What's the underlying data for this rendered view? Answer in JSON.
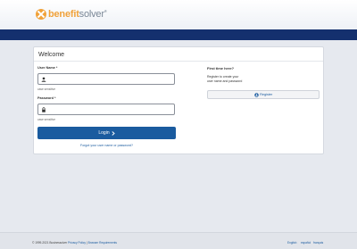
{
  "brand": {
    "name_part1": "benefit",
    "name_part2": "solver",
    "registered_mark": "®"
  },
  "colors": {
    "brand_orange": "#f0a23a",
    "nav_blue": "#14306e",
    "primary_button": "#1a5b9f",
    "link": "#1a5b9f"
  },
  "login": {
    "title": "Welcome",
    "username_label": "User Name *",
    "username_hint": "case sensitive",
    "username_value": "",
    "password_label": "Password *",
    "password_hint": "case sensitive",
    "password_value": "",
    "login_button": "Login",
    "forgot_link": "Forgot your user name or password?"
  },
  "register": {
    "title": "First time here?",
    "line1": "Register to create your",
    "line2": "user name and password",
    "button": "Register"
  },
  "footer": {
    "copyright": "© 1999-2021 Businessolver",
    "privacy_link": "Privacy Policy",
    "separator": "|",
    "browser_link": "Browser Requirements",
    "languages": [
      "English",
      "español",
      "français"
    ]
  },
  "icons": {
    "logo": "benefitsolver-logo-icon",
    "username": "user-icon",
    "password": "lock-icon",
    "login_arrow": "chevron-right-icon",
    "register": "user-plus-icon"
  }
}
